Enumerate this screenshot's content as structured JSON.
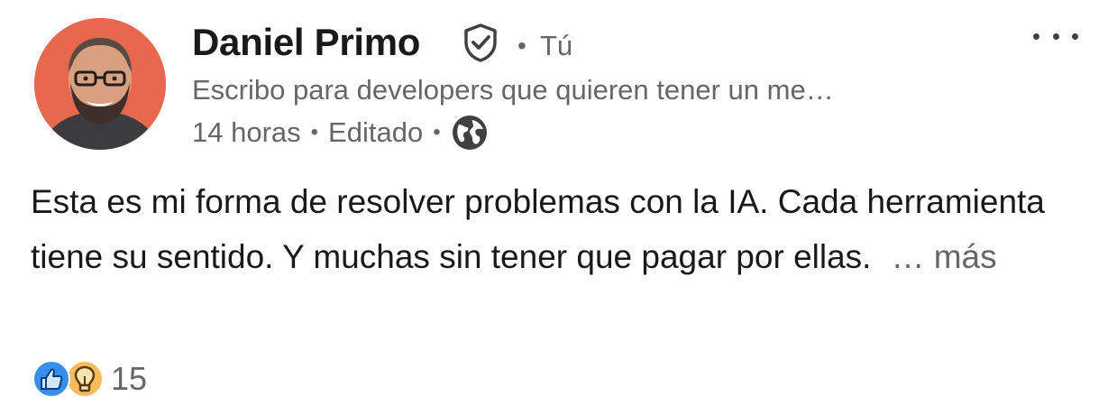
{
  "author": {
    "name": "Daniel Primo",
    "relation": "Tú",
    "headline": "Escribo para developers que quieren tener un me…",
    "avatar_bg": "#e8674f"
  },
  "meta": {
    "time": "14 horas",
    "edited": "Editado",
    "visibility_icon": "globe-icon"
  },
  "post": {
    "text": "Esta es mi forma de resolver problemas con la IA. Cada herramienta tiene su sentido. Y muchas sin tener que pagar por ellas.",
    "see_more": "… más"
  },
  "reactions": {
    "types": [
      "like",
      "insightful"
    ],
    "count": "15"
  },
  "icons": {
    "verified": "verified-shield-icon",
    "more": "more-options-icon"
  },
  "colors": {
    "like": "#378fe9",
    "insightful": "#f5bb5c",
    "secondary_text": "#666666"
  }
}
